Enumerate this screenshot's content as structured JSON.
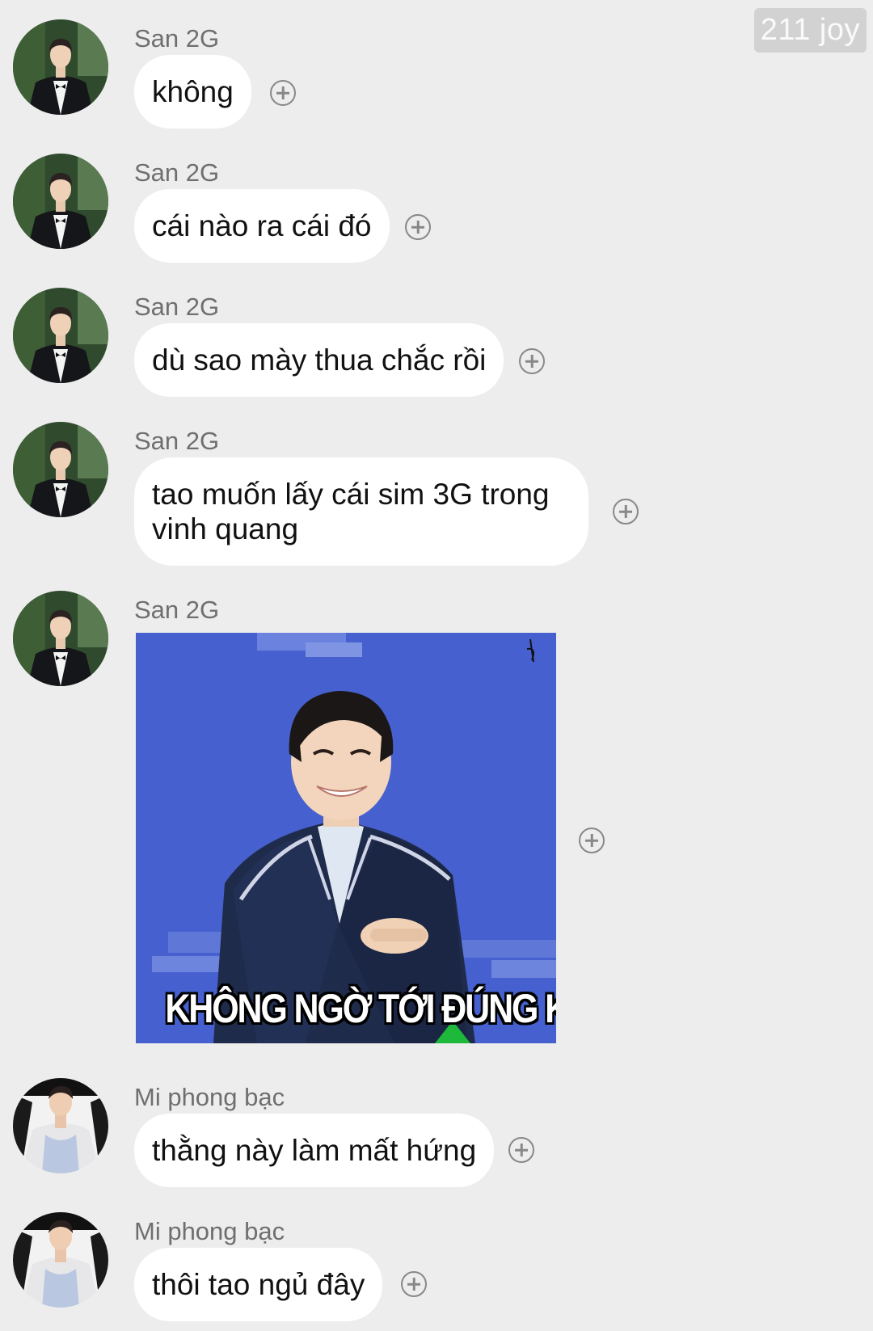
{
  "watermark": "211 joy",
  "messages": [
    {
      "sender": "San 2G",
      "avatar": "suit-man-avatar",
      "text": "không"
    },
    {
      "sender": "San 2G",
      "avatar": "suit-man-avatar",
      "text": "cái nào ra cái đó"
    },
    {
      "sender": "San 2G",
      "avatar": "suit-man-avatar",
      "text": "dù sao mày thua chắc rồi"
    },
    {
      "sender": "San 2G",
      "avatar": "suit-man-avatar",
      "text": "tao muốn lấy cái sim 3G trong vinh quang"
    },
    {
      "sender": "San 2G",
      "avatar": "suit-man-avatar",
      "sticker_caption": "KHÔNG NGỜ TỚI ĐÚNG KHÔNG"
    },
    {
      "sender": "Mi phong bạc",
      "avatar": "tank-top-man-avatar",
      "text": "thằng này làm mất hứng"
    },
    {
      "sender": "Mi phong bạc",
      "avatar": "tank-top-man-avatar",
      "text": "thôi tao ngủ đây"
    }
  ],
  "icons": {
    "reaction": "add-reaction-icon"
  },
  "colors": {
    "background": "#ededed",
    "bubble": "#ffffff",
    "sender_name": "#6f6f6f",
    "sticker_background": "#4661cf"
  }
}
